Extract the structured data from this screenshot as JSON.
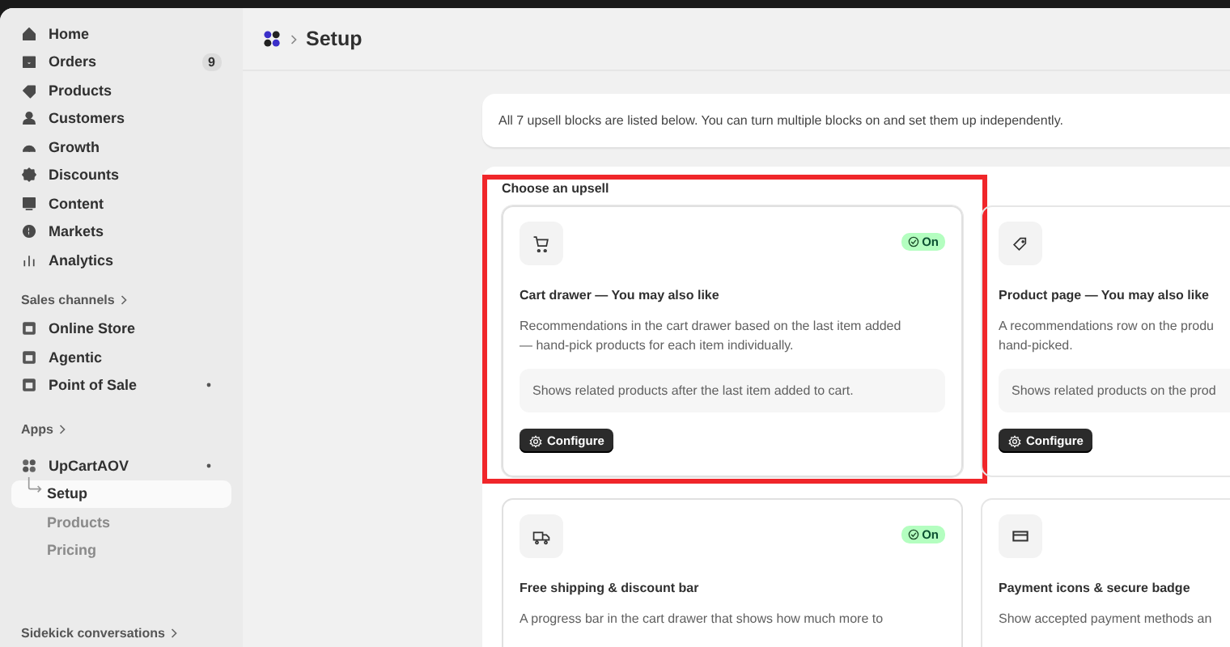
{
  "sidebar": {
    "nav": [
      {
        "label": "Home"
      },
      {
        "label": "Orders",
        "badge": "9"
      },
      {
        "label": "Products"
      },
      {
        "label": "Customers"
      },
      {
        "label": "Growth"
      },
      {
        "label": "Discounts"
      },
      {
        "label": "Content"
      },
      {
        "label": "Markets"
      },
      {
        "label": "Analytics"
      }
    ],
    "sales_channels": {
      "heading": "Sales channels",
      "items": [
        {
          "label": "Online Store",
          "pinned": false
        },
        {
          "label": "Agentic",
          "pinned": false
        },
        {
          "label": "Point of Sale",
          "pinned": true
        }
      ]
    },
    "apps": {
      "heading": "Apps",
      "app": {
        "label": "UpCartAOV",
        "pinned": true,
        "children": [
          {
            "label": "Setup",
            "selected": true
          },
          {
            "label": "Products",
            "selected": false
          },
          {
            "label": "Pricing",
            "selected": false
          }
        ]
      }
    },
    "footer_heading": "Sidekick conversations"
  },
  "header": {
    "title": "Setup"
  },
  "intro": "All 7 upsell blocks are listed below. You can turn multiple blocks on and set them up independently.",
  "section_title": "Choose an upsell",
  "cards": [
    {
      "title": "Cart drawer — You may also like",
      "on": true,
      "highlighted": true,
      "description": [
        "Recommendations in the cart drawer based on the last item added",
        "— hand-pick products for each item individually."
      ],
      "note": "Shows related products after the last item added to cart.",
      "button": "Configure",
      "badge": "On"
    },
    {
      "title": "Product page — You may also like",
      "highlighted": false,
      "description": [
        "A recommendations row on the produ",
        "hand-picked."
      ],
      "note": "Shows related products on the prod",
      "button": "Configure"
    },
    {
      "title": "Free shipping & discount bar",
      "on": true,
      "highlighted": false,
      "description": [
        "A progress bar in the cart drawer that shows how much more to"
      ],
      "badge": "On"
    },
    {
      "title": "Payment icons & secure badge",
      "highlighted": false,
      "description": [
        "Show accepted payment methods an"
      ]
    }
  ]
}
